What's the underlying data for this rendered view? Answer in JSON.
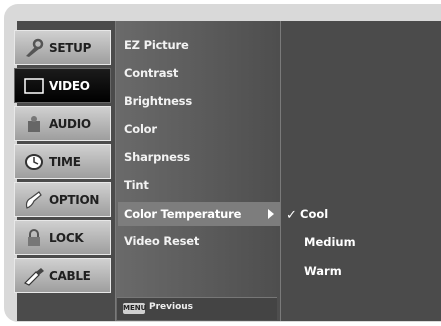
{
  "categories": [
    {
      "label": "SETUP",
      "icon": "setup-icon"
    },
    {
      "label": "VIDEO",
      "icon": "tv-screen-icon",
      "active": true
    },
    {
      "label": "AUDIO",
      "icon": "audio-icon"
    },
    {
      "label": "TIME",
      "icon": "clock-icon"
    },
    {
      "label": "OPTION",
      "icon": "option-icon"
    },
    {
      "label": "LOCK",
      "icon": "lock-icon"
    },
    {
      "label": "CABLE",
      "icon": "cable-icon"
    }
  ],
  "video_menu": {
    "items": [
      "EZ Picture",
      "Contrast",
      "Brightness",
      "Color",
      "Sharpness",
      "Tint",
      "Color Temperature",
      "Video Reset"
    ],
    "selected": "Color Temperature"
  },
  "footer": {
    "key_label": "MENU",
    "text": "Previous"
  },
  "color_temperature": {
    "options": [
      "Cool",
      "Medium",
      "Warm"
    ],
    "current": "Cool"
  },
  "colors": {
    "panel": "#4b4b4b",
    "frame": "#d9d9d9",
    "highlight": "#7d7d7d"
  }
}
